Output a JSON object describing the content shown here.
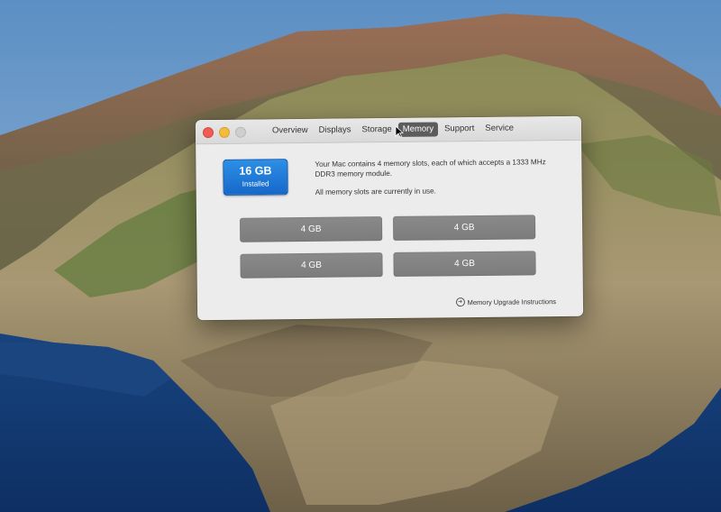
{
  "window": {
    "tabs": [
      {
        "label": "Overview",
        "active": false
      },
      {
        "label": "Displays",
        "active": false
      },
      {
        "label": "Storage",
        "active": false
      },
      {
        "label": "Memory",
        "active": true
      },
      {
        "label": "Support",
        "active": false
      },
      {
        "label": "Service",
        "active": false
      }
    ]
  },
  "memory": {
    "total": "16 GB",
    "total_label": "Installed",
    "description": "Your Mac contains 4 memory slots, each of which accepts a 1333 MHz DDR3 memory module.",
    "status": "All memory slots are currently in use.",
    "slots": [
      "4 GB",
      "4 GB",
      "4 GB",
      "4 GB"
    ],
    "upgrade_link": "Memory Upgrade Instructions"
  },
  "colors": {
    "accent": "#1e77d8",
    "slot": "#838383",
    "active_tab": "#5c5c5c"
  },
  "icons": {
    "upgrade_link_icon": "arrow-circle-icon",
    "pointer": "mouse-cursor-icon"
  }
}
